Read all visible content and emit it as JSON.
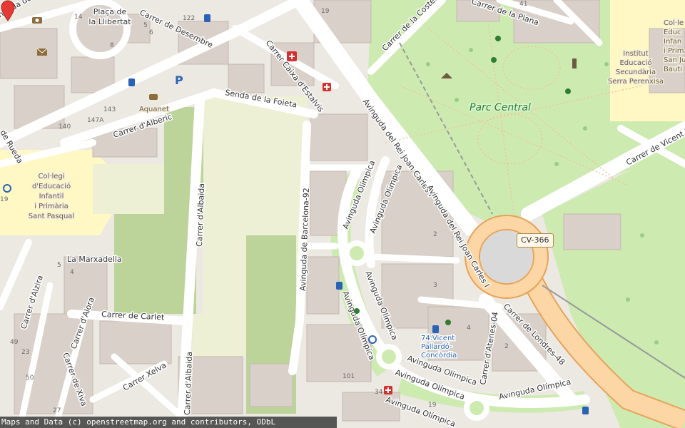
{
  "map": {
    "marker": {
      "name": "location-marker",
      "color": "#e53935"
    },
    "road_shield": "CV-366",
    "park_name": "Parc Central",
    "streets": [
      "Plaça de",
      "la Llibertat",
      "Carrer de Desembre",
      "Carrer de la Costera",
      "Carrer de la Plana",
      "Carrer Caixa d'Estalvis",
      "Senda de la Foieta",
      "Carrer d'Alberic",
      "Avinguda del Rei Joan Carles I",
      "Avinguda del Rei Joan Carles I",
      "Carrer de Vicent P",
      "Avinguda Olímpica",
      "Avinguda Olímpica",
      "Avinguda Olímpica",
      "Avinguda Olímpica",
      "Avinguda Olímpica",
      "Avinguda Olímpica",
      "Avinguda Olímpica",
      "Avinguda Olímpica",
      "Avinguda de Barcelona-92",
      "Carrer d'Albaida",
      "Carrer d'Albaida",
      "Carrer de Carlet",
      "Carrer d'Alzira",
      "Carrer d'Alora",
      "Carrer de Xiva",
      "Carrer Xelva",
      "Carrer de Londres-48",
      "Carrer d'Atenes-04",
      "de Rueda",
      "nguda de"
    ],
    "places": [
      "Col·legi",
      "d'Educació",
      "Infantil",
      "i Primària",
      "Sant Pasqual",
      "La Marxadella",
      "Aquanet",
      "Institut",
      "Educació",
      "Secundària",
      "Serra Perenxisa",
      "Col·le",
      "Educ",
      "Infan",
      "i Prim",
      "San Ju",
      "Bauti"
    ],
    "transit": [
      "74.Vicent",
      "Pallardó-",
      "Concòrdia"
    ],
    "house_numbers": [
      "14",
      "5",
      "6",
      "8",
      "122",
      "147A",
      "143",
      "140",
      "5",
      "4",
      "49",
      "19",
      "23",
      "27",
      "50",
      "34",
      "101",
      "2",
      "3",
      "4",
      "2",
      "41",
      "19",
      "19"
    ],
    "icons": [
      "camera-icon",
      "mail-icon",
      "bus-stop-icon",
      "parking-icon",
      "taxi-icon",
      "pharmacy-icon",
      "pharmacy-icon",
      "playground-icon",
      "playground-icon",
      "monument-icon",
      "shelter-icon",
      "bicycle-rental-icon",
      "bus-stop-icon",
      "bus-stop-icon",
      "pharmacy-icon",
      "pedestrian-icon"
    ]
  },
  "attribution": "Maps and Data (c) openstreetmap.org and contributors, ODbL",
  "colors": {
    "park": "#cdebb0",
    "park_dark": "#b7e0a0",
    "farmland": "#eef0d5",
    "grass": "#bcd39a",
    "school": "#fff7c4",
    "building": "#d9d0c9",
    "road": "#ffffff",
    "primary_road": "#fcd6a4",
    "residential": "#e0dfdf"
  }
}
